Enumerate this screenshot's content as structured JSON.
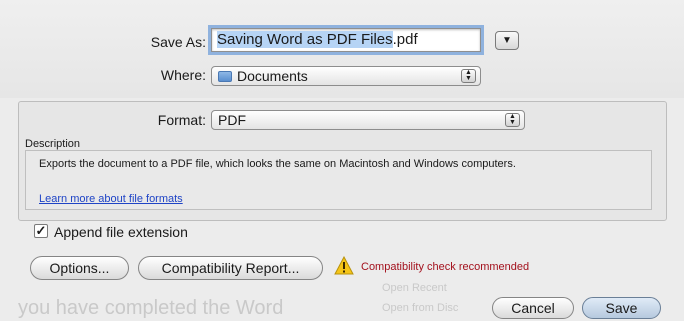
{
  "background_ghost_text": {
    "line1": "you have completed the Word",
    "line2": "Open Recent",
    "line3": "Open from Disc"
  },
  "save_as": {
    "label": "Save As:",
    "filename_selected": "Saving Word as PDF Files",
    "filename_ext": ".pdf",
    "expand_icon": "triangle-down-icon"
  },
  "where": {
    "label": "Where:",
    "value": "Documents",
    "icon": "folder-icon"
  },
  "format": {
    "label": "Format:",
    "value": "PDF"
  },
  "description": {
    "heading": "Description",
    "text": "Exports the document to a PDF file, which looks the same on Macintosh and Windows computers.",
    "link": "Learn more about file formats"
  },
  "append_extension": {
    "label": "Append file extension",
    "checked": true
  },
  "buttons": {
    "options": "Options...",
    "compatibility_report": "Compatibility Report...",
    "cancel": "Cancel",
    "save": "Save"
  },
  "warning": {
    "text": "Compatibility check recommended",
    "icon": "warning-icon",
    "color": "#a3111d"
  },
  "colors": {
    "link": "#1f44c6",
    "selection": "#b6d4f5",
    "focus_ring": "#8fb2de"
  }
}
